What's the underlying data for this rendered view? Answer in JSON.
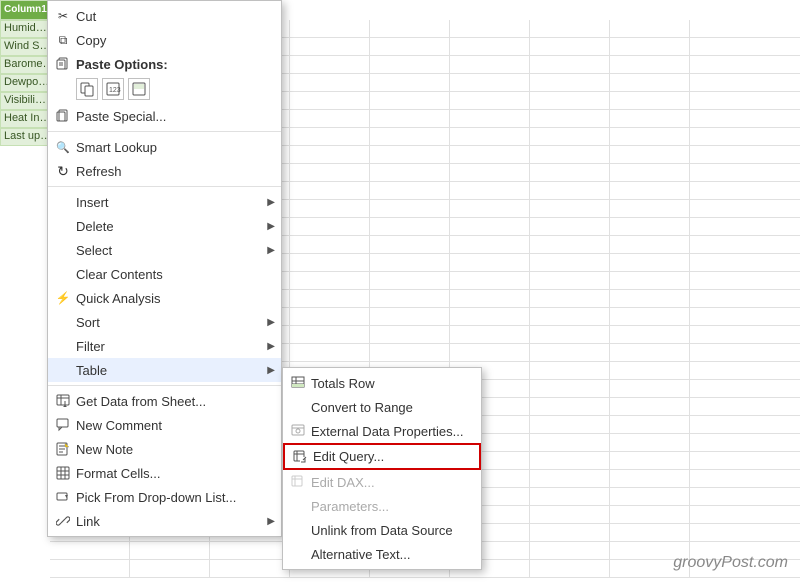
{
  "spreadsheet": {
    "left_cells": [
      {
        "label": "Column1",
        "class": "header"
      },
      {
        "label": "Humid…",
        "class": ""
      },
      {
        "label": "Wind S…",
        "class": ""
      },
      {
        "label": "Barome…",
        "class": ""
      },
      {
        "label": "Dewpo…",
        "class": ""
      },
      {
        "label": "Visibili…",
        "class": ""
      },
      {
        "label": "Heat In…",
        "class": ""
      },
      {
        "label": "Last up…",
        "class": ""
      }
    ]
  },
  "context_menu": {
    "items": [
      {
        "id": "cut",
        "label": "Cut",
        "icon": "scissors",
        "has_arrow": false,
        "disabled": false,
        "separator_after": false
      },
      {
        "id": "copy",
        "label": "Copy",
        "icon": "copy",
        "has_arrow": false,
        "disabled": false,
        "separator_after": false
      },
      {
        "id": "paste-options",
        "label": "Paste Options:",
        "icon": "paste",
        "is_section": true,
        "has_arrow": false,
        "disabled": false,
        "separator_after": false
      },
      {
        "id": "paste-special",
        "label": "Paste Special...",
        "icon": "paste-special",
        "has_arrow": false,
        "disabled": false,
        "separator_after": true
      },
      {
        "id": "smart-lookup",
        "label": "Smart Lookup",
        "icon": "search",
        "has_arrow": false,
        "disabled": false,
        "separator_after": false
      },
      {
        "id": "refresh",
        "label": "Refresh",
        "icon": "refresh",
        "has_arrow": false,
        "disabled": false,
        "separator_after": true
      },
      {
        "id": "insert",
        "label": "Insert",
        "icon": "",
        "has_arrow": true,
        "disabled": false,
        "separator_after": false
      },
      {
        "id": "delete",
        "label": "Delete",
        "icon": "",
        "has_arrow": true,
        "disabled": false,
        "separator_after": false
      },
      {
        "id": "select",
        "label": "Select",
        "icon": "",
        "has_arrow": true,
        "disabled": false,
        "separator_after": false
      },
      {
        "id": "clear-contents",
        "label": "Clear Contents",
        "icon": "",
        "has_arrow": false,
        "disabled": false,
        "separator_after": false
      },
      {
        "id": "quick-analysis",
        "label": "Quick Analysis",
        "icon": "analysis",
        "has_arrow": false,
        "disabled": false,
        "separator_after": false
      },
      {
        "id": "sort",
        "label": "Sort",
        "icon": "",
        "has_arrow": true,
        "disabled": false,
        "separator_after": false
      },
      {
        "id": "filter",
        "label": "Filter",
        "icon": "",
        "has_arrow": true,
        "disabled": false,
        "separator_after": false
      },
      {
        "id": "table",
        "label": "Table",
        "icon": "",
        "has_arrow": true,
        "disabled": false,
        "separator_after": true,
        "highlighted": true
      },
      {
        "id": "get-data",
        "label": "Get Data from Sheet...",
        "icon": "getdata",
        "has_arrow": false,
        "disabled": false,
        "separator_after": false
      },
      {
        "id": "new-comment",
        "label": "New Comment",
        "icon": "comment",
        "has_arrow": false,
        "disabled": false,
        "separator_after": false
      },
      {
        "id": "new-note",
        "label": "New Note",
        "icon": "note",
        "has_arrow": false,
        "disabled": false,
        "separator_after": false
      },
      {
        "id": "format-cells",
        "label": "Format Cells...",
        "icon": "format",
        "has_arrow": false,
        "disabled": false,
        "separator_after": false
      },
      {
        "id": "pick-dropdown",
        "label": "Pick From Drop-down List...",
        "icon": "dropdown",
        "has_arrow": false,
        "disabled": false,
        "separator_after": false
      },
      {
        "id": "link",
        "label": "Link",
        "icon": "link",
        "has_arrow": true,
        "disabled": false,
        "separator_after": false
      }
    ]
  },
  "table_submenu": {
    "items": [
      {
        "id": "totals-row",
        "label": "Totals Row",
        "icon": "",
        "disabled": false
      },
      {
        "id": "convert-to-range",
        "label": "Convert to Range",
        "icon": "",
        "disabled": false
      },
      {
        "id": "external-data-props",
        "label": "External Data Properties...",
        "icon": "",
        "disabled": false
      },
      {
        "id": "edit-query",
        "label": "Edit Query...",
        "icon": "editquery",
        "disabled": false,
        "highlighted": true
      },
      {
        "id": "edit-dax",
        "label": "Edit DAX...",
        "icon": "",
        "disabled": true
      },
      {
        "id": "parameters",
        "label": "Parameters...",
        "icon": "",
        "disabled": true
      },
      {
        "id": "unlink-data-source",
        "label": "Unlink from Data Source",
        "icon": "",
        "disabled": false
      },
      {
        "id": "alternative-text",
        "label": "Alternative Text...",
        "icon": "",
        "disabled": false
      }
    ]
  },
  "watermark": {
    "text": "groovyPost.com"
  }
}
